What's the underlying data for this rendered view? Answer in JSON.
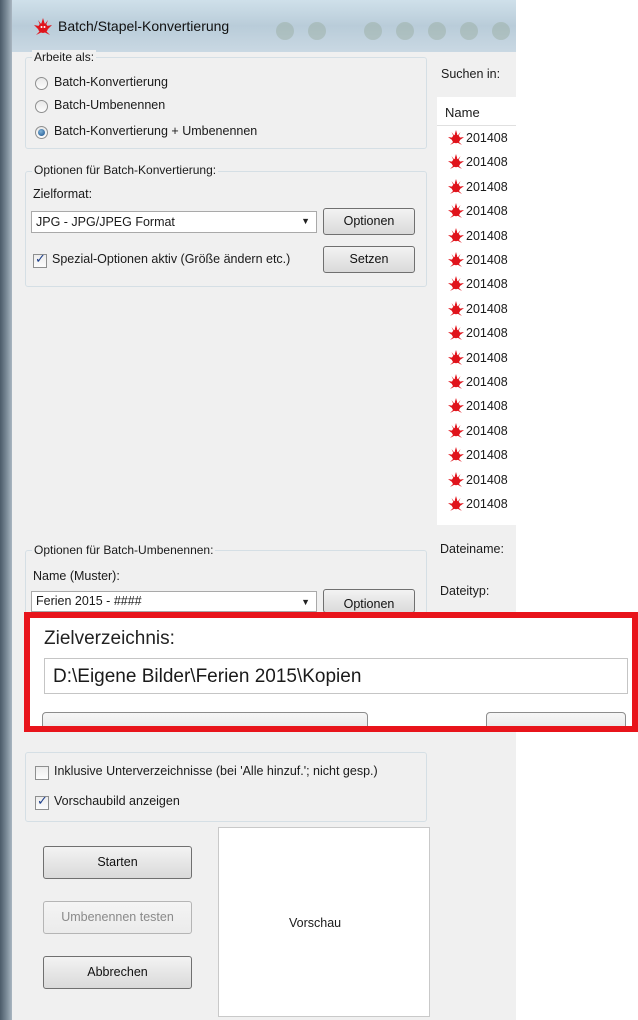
{
  "window": {
    "title": "Batch/Stapel-Konvertierung"
  },
  "work_as": {
    "label": "Arbeite als:",
    "options": [
      "Batch-Konvertierung",
      "Batch-Umbenennen",
      "Batch-Konvertierung + Umbenennen"
    ],
    "selected_index": 2
  },
  "conversion": {
    "label": "Optionen für Batch-Konvertierung:",
    "target_format_label": "Zielformat:",
    "target_format_value": "JPG - JPG/JPEG Format",
    "options_button": "Optionen",
    "special_label": "Spezial-Optionen aktiv (Größe ändern etc.)",
    "special_checked": true,
    "set_button": "Setzen"
  },
  "rename": {
    "label": "Optionen für Batch-Umbenennen:",
    "name_label": "Name (Muster):",
    "name_value": "Ferien 2015 - ####",
    "options_button": "Optionen"
  },
  "target_dir": {
    "label": "Zielverzeichnis:",
    "value": "D:\\Eigene Bilder\\Ferien 2015\\Kopien"
  },
  "checks": {
    "subdirs_label": "Inklusive Unterverzeichnisse (bei 'Alle hinzuf.'; nicht gesp.)",
    "subdirs_checked": false,
    "thumb_label": "Vorschaubild anzeigen",
    "thumb_checked": true
  },
  "buttons": {
    "start": "Starten",
    "test_rename": "Umbenennen testen",
    "cancel": "Abbrechen"
  },
  "preview": {
    "label": "Vorschau"
  },
  "file_pane": {
    "search_in_label": "Suchen in:",
    "column_name": "Name",
    "files": [
      "201408",
      "201408",
      "201408",
      "201408",
      "201408",
      "201408",
      "201408",
      "201408",
      "201408",
      "201408",
      "201408",
      "201408",
      "201408",
      "201408",
      "201408",
      "201408"
    ],
    "filename_label": "Dateiname:",
    "filetype_label": "Dateityp:"
  },
  "icons": {
    "app": "irfanview-cat-icon",
    "file": "irfanview-file-icon"
  },
  "colors": {
    "highlight_border": "#e8141b",
    "radio_dot": "#164f8b"
  }
}
